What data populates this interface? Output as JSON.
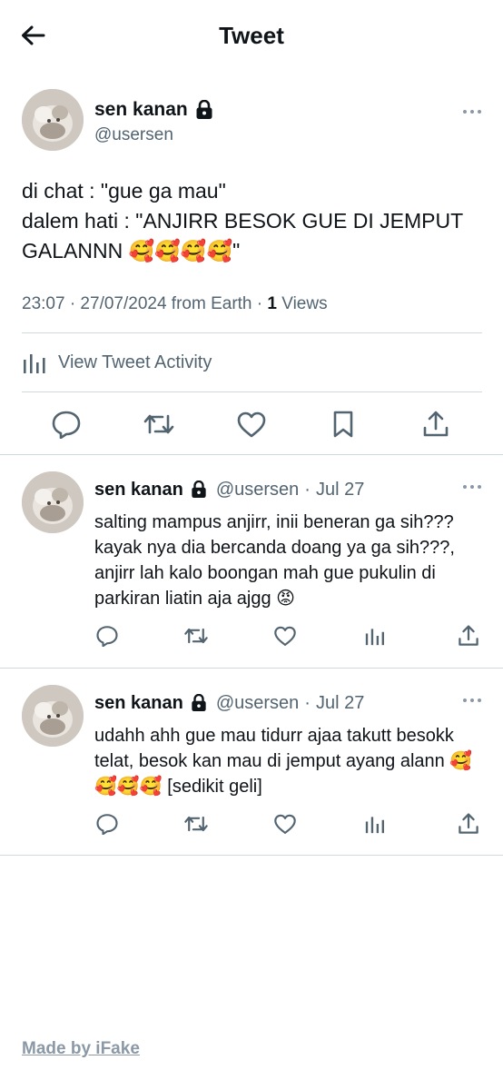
{
  "header": {
    "title": "Tweet",
    "back_icon": "arrow-left-icon"
  },
  "main_tweet": {
    "author_name": "sen kanan",
    "handle": "@usersen",
    "text_line1": "di chat : \"gue ga mau\"",
    "text_line2": "dalem hati : \"ANJIRR BESOK GUE DI JEMPUT GALANNN 🥰🥰🥰🥰\"",
    "meta_prefix": "23:07 · 27/07/2024 from Earth · ",
    "views_count": "1",
    "views_label": " Views",
    "activity_label": "View Tweet Activity",
    "actions": [
      "reply-icon",
      "retweet-icon",
      "like-icon",
      "bookmark-icon",
      "share-icon"
    ]
  },
  "replies": [
    {
      "author_name": "sen kanan",
      "handle": "@usersen",
      "separator": "·",
      "date": "Jul 27",
      "text": "salting mampus anjirr, inii beneran ga sih??? kayak nya dia bercanda doang ya ga sih???, anjirr lah kalo boongan mah gue pukulin di parkiran liatin aja ajgg 😡"
    },
    {
      "author_name": "sen kanan",
      "handle": "@usersen",
      "separator": "·",
      "date": "Jul 27",
      "text": "udahh ahh gue mau tidurr ajaa takutt besokk telat, besok kan mau di jemput ayang alann 🥰🥰🥰🥰 [sedikit geli]"
    }
  ],
  "reply_actions": [
    "reply-icon",
    "retweet-icon",
    "like-icon",
    "analytics-icon",
    "share-icon"
  ],
  "footer": {
    "link": "Made by iFake"
  },
  "colors": {
    "text": "#0f1419",
    "secondary": "#536471",
    "divider": "#cfd9de",
    "footer": "#8b98a5"
  }
}
